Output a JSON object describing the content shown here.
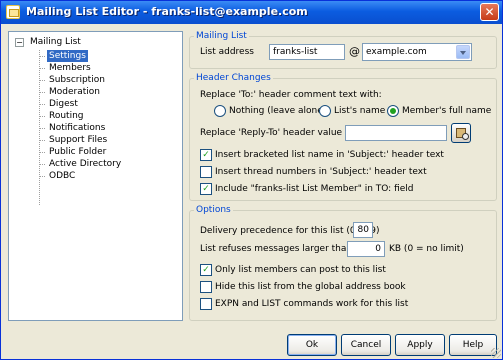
{
  "window": {
    "title": "Mailing List Editor - franks-list@example.com",
    "close_glyph": "✕"
  },
  "tree": {
    "expander_glyph": "−",
    "root": "Mailing List",
    "items": [
      "Settings",
      "Members",
      "Subscription",
      "Moderation",
      "Digest",
      "Routing",
      "Notifications",
      "Support Files",
      "Public Folder",
      "Active Directory",
      "ODBC"
    ],
    "selected": "Settings"
  },
  "mailing_list": {
    "legend": "Mailing List",
    "address_label": "List address",
    "local_part": "franks-list",
    "at_sign": "@",
    "domain": "example.com"
  },
  "header_changes": {
    "legend": "Header Changes",
    "replace_to_label": "Replace 'To:' header comment text with:",
    "radios": [
      {
        "label": "Nothing (leave alone)",
        "checked": false
      },
      {
        "label": "List's name",
        "checked": false
      },
      {
        "label": "Member's full name",
        "checked": true
      }
    ],
    "reply_to_label": "Replace 'Reply-To' header value with",
    "reply_to_value": "",
    "checkboxes": [
      {
        "label": "Insert bracketed list name in 'Subject:' header text",
        "checked": true
      },
      {
        "label": "Insert thread numbers in 'Subject:' header text",
        "checked": false
      },
      {
        "label": "Include \"franks-list List Member\" in TO: field",
        "checked": true
      }
    ]
  },
  "options": {
    "legend": "Options",
    "precedence_label": "Delivery precedence for this list (0 - 99)",
    "precedence_value": "80",
    "size_label": "List refuses messages larger than",
    "size_value": "0",
    "size_suffix": "KB (0 = no limit)",
    "checkboxes": [
      {
        "label": "Only list members can post to this list",
        "checked": true
      },
      {
        "label": "Hide this list from the global address book",
        "checked": false
      },
      {
        "label": "EXPN and LIST commands work for this list",
        "checked": false
      }
    ]
  },
  "buttons": {
    "ok": "Ok",
    "cancel": "Cancel",
    "apply": "Apply",
    "help": "Help"
  },
  "check_glyph": "✓"
}
